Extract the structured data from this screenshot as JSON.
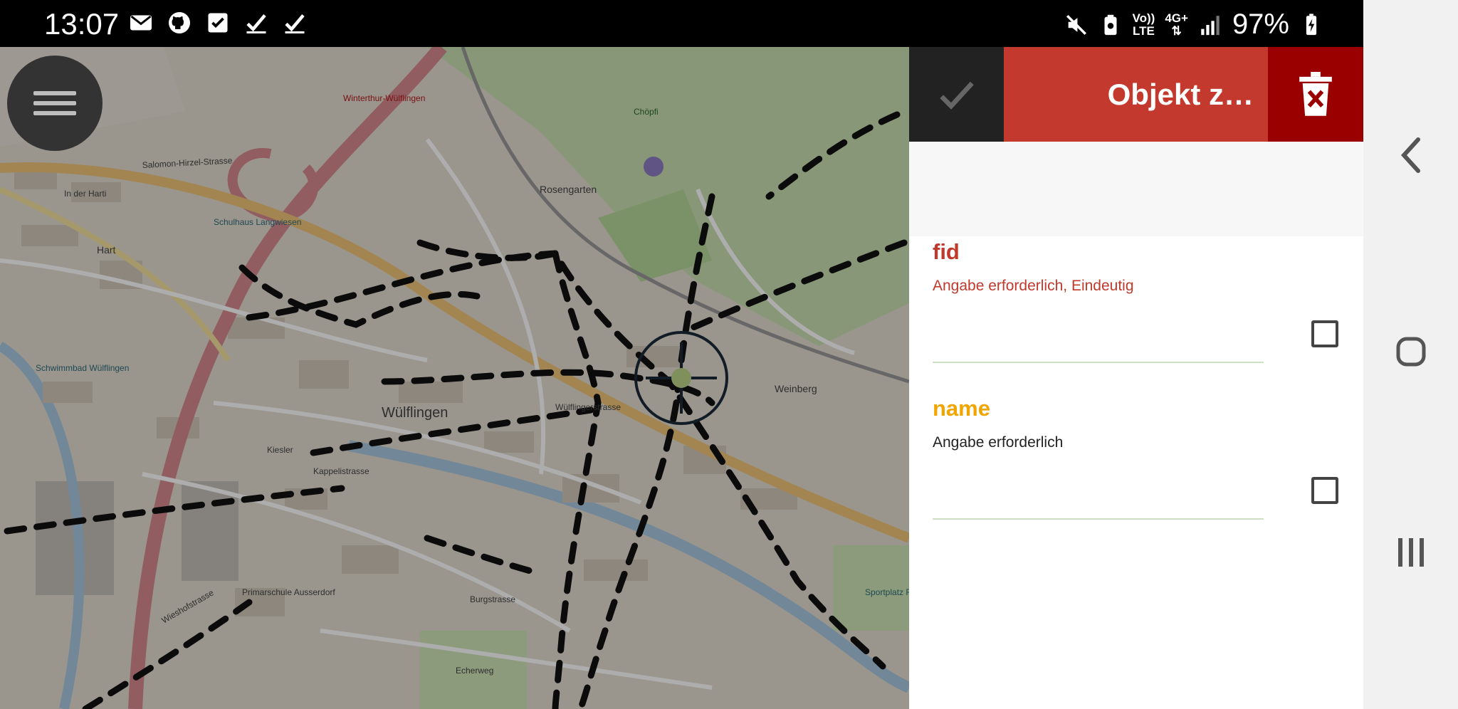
{
  "status_bar": {
    "time": "13:07",
    "left_icons": [
      "mail-icon",
      "github-icon",
      "checkbox-icon",
      "check-icon",
      "check-icon"
    ],
    "network_top": "Vo))",
    "network_bottom": "LTE",
    "network_gen": "4G+",
    "battery": "97%"
  },
  "map": {
    "labels": [
      "Winterthur-Wülflingen",
      "Wülflingen",
      "Rosengarten",
      "Weinberg",
      "Salomon-Hirzel-Strasse",
      "Hart",
      "In der Harti",
      "Schwimmbad Wülflingen",
      "Kiesler",
      "Primarschule Ausserdorf",
      "Sportplatz Flüeli",
      "Burgstrasse",
      "Echerweg",
      "Wieshofstrasse",
      "Chöpfi",
      "Schulhaus Langwiesen",
      "Wülflingerstrasse",
      "Kappelistrasse"
    ]
  },
  "panel": {
    "title": "Objekt z…",
    "fields": [
      {
        "name": "fid",
        "hint": "Angabe erforderlich, Eindeutig",
        "name_color": "#c0392b",
        "hint_color": "#c0392b"
      },
      {
        "name": "name",
        "hint": "Angabe erforderlich",
        "name_color": "#f0a500",
        "hint_color": "#222222"
      }
    ]
  },
  "colors": {
    "accent_red": "#c4392d",
    "delete_red": "#9a0000"
  }
}
